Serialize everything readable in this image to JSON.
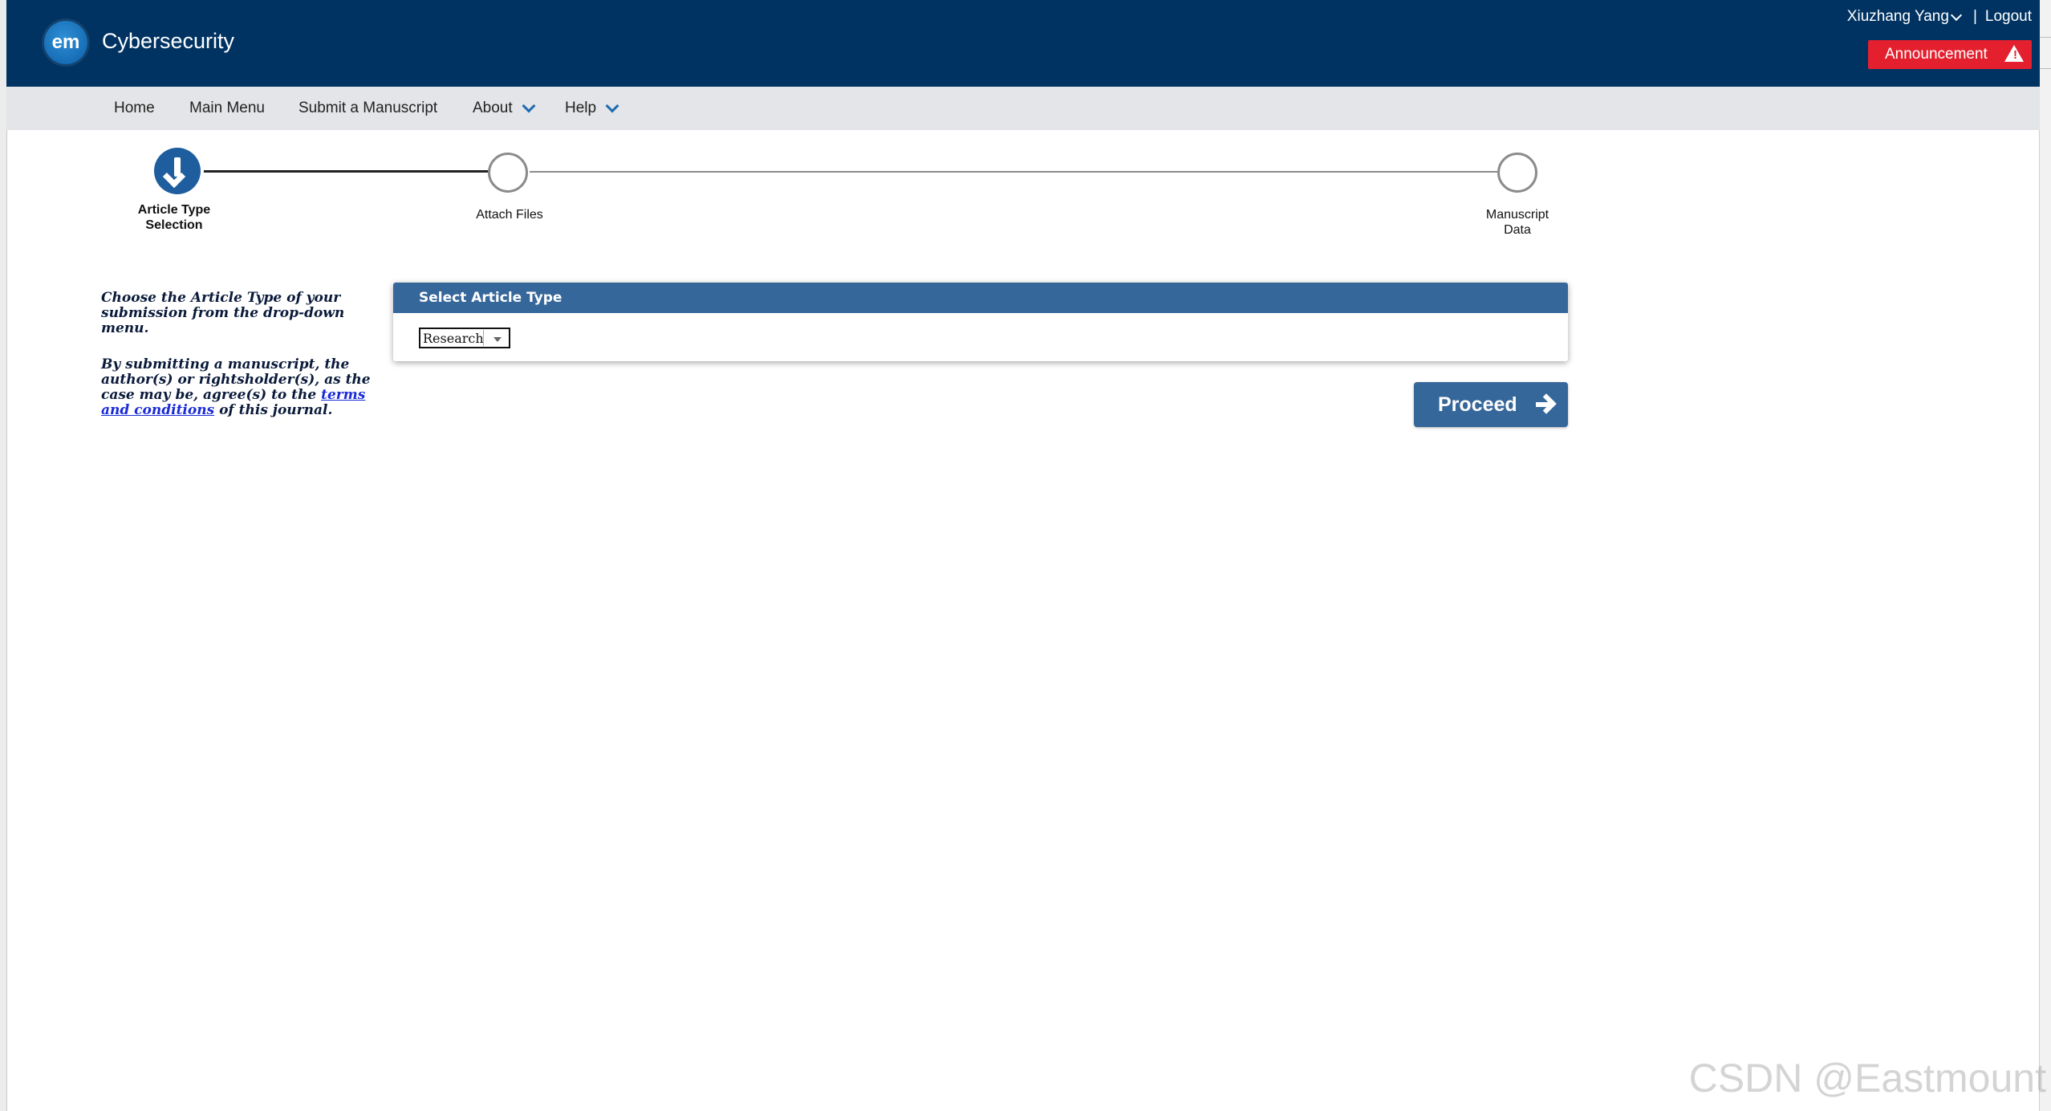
{
  "header": {
    "logo_text": "em",
    "journal_name": "Cybersecurity",
    "user_name": "Xiuzhang Yang",
    "separator": "|",
    "logout_label": "Logout",
    "announcement_label": "Announcement",
    "announcement_icon": "warning-icon",
    "bg_color": "#003362",
    "announcement_color": "#e4202e"
  },
  "nav": {
    "items": [
      {
        "label": "Home"
      },
      {
        "label": "Main Menu"
      },
      {
        "label": "Submit a Manuscript"
      },
      {
        "label": "About"
      },
      {
        "label": "Help"
      }
    ]
  },
  "stepper": {
    "steps": [
      {
        "label_line1": "Article Type",
        "label_line2": "Selection",
        "state": "current"
      },
      {
        "label_line1": "Attach Files",
        "label_line2": "",
        "state": "pending"
      },
      {
        "label_line1": "Manuscript",
        "label_line2": "Data",
        "state": "pending"
      }
    ]
  },
  "instructions": {
    "para1": "Choose the Article Type of your submission from the drop-down menu.",
    "para2_prefix": "By submitting a manuscript, the author(s) or rightsholder(s), as the case may be, agree(s) to the ",
    "para2_link": "terms and conditions",
    "para2_suffix": " of this journal."
  },
  "article_type_panel": {
    "title": "Select Article Type",
    "selected_value": "Research",
    "accent_color": "#36679a"
  },
  "actions": {
    "proceed_label": "Proceed",
    "proceed_icon": "arrow-right-icon"
  },
  "watermark": "CSDN @Eastmount"
}
